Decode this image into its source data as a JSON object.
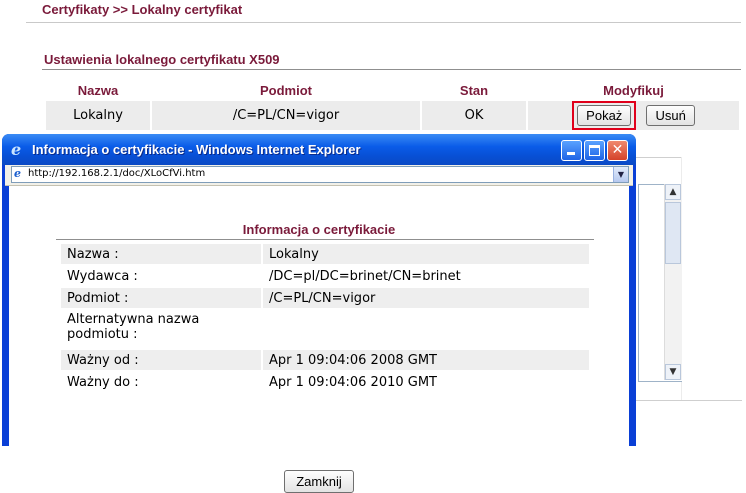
{
  "page": {
    "breadcrumb": "Certyfikaty >> Lokalny certyfikat",
    "section_title": "Ustawienia lokalnego certyfikatu X509",
    "table": {
      "headers": [
        "Nazwa",
        "Podmiot",
        "Stan",
        "Modyfikuj"
      ],
      "row": {
        "name": "Lokalny",
        "subject": "/C=PL/CN=vigor",
        "status": "OK"
      },
      "show_label": "Pokaż",
      "delete_label": "Usuń"
    }
  },
  "popup": {
    "window_title": "Informacja o certyfikacie - Windows Internet Explorer",
    "url": "http://192.168.2.1/doc/XLoCfVi.htm",
    "heading": "Informacja o certyfikacie",
    "rows": [
      {
        "label": "Nazwa :",
        "value": "Lokalny"
      },
      {
        "label": "Wydawca :",
        "value": "/DC=pl/DC=brinet/CN=brinet"
      },
      {
        "label": "Podmiot :",
        "value": "/C=PL/CN=vigor"
      },
      {
        "label": "Alternatywna nazwa podmiotu :",
        "value": ""
      },
      {
        "label": "Ważny od :",
        "value": "Apr 1 09:04:06 2008 GMT"
      },
      {
        "label": "Ważny do :",
        "value": "Apr 1 09:04:06 2010 GMT"
      }
    ],
    "close_label": "Zamknij"
  },
  "colors": {
    "accent": "#7a1a3a",
    "titlebar": "#0a5ce8",
    "highlight": "#e0001b"
  },
  "icons": {
    "title": "ie-logo-icon",
    "address": "ie-page-icon"
  }
}
